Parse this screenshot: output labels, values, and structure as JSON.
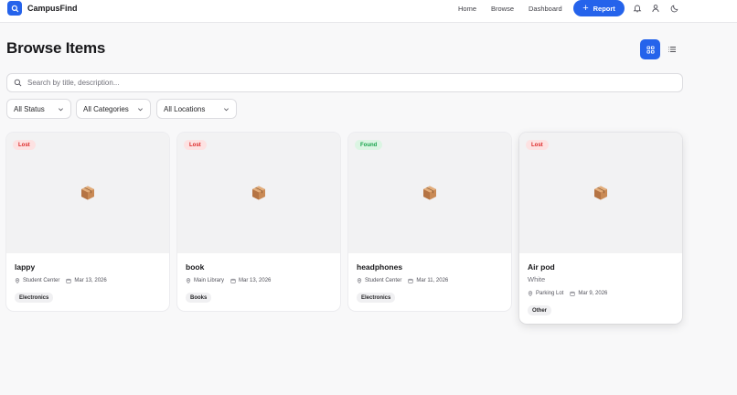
{
  "brand": {
    "name": "CampusFind",
    "accent": "#2563eb"
  },
  "nav": {
    "links": [
      "Home",
      "Browse",
      "Dashboard"
    ],
    "report_label": "Report",
    "icons": [
      "bell-icon",
      "user-icon",
      "moon-icon"
    ]
  },
  "page": {
    "title": "Browse Items"
  },
  "search": {
    "placeholder": "Search by title, description..."
  },
  "filters": [
    "All Status",
    "All Categories",
    "All Locations"
  ],
  "items": [
    {
      "status": "Lost",
      "title": "lappy",
      "subtitle": "",
      "location": "Student Center",
      "date": "Mar 13, 2026",
      "category": "Electronics"
    },
    {
      "status": "Lost",
      "title": "book",
      "subtitle": "",
      "location": "Main Library",
      "date": "Mar 13, 2026",
      "category": "Books"
    },
    {
      "status": "Found",
      "title": "headphones",
      "subtitle": "",
      "location": "Student Center",
      "date": "Mar 11, 2026",
      "category": "Electronics"
    },
    {
      "status": "Lost",
      "title": "Air pod",
      "subtitle": "White",
      "location": "Parking Lot",
      "date": "Mar 9, 2026",
      "category": "Other"
    }
  ],
  "status_colors": {
    "lost": "#dc2626",
    "found": "#16a34a"
  }
}
